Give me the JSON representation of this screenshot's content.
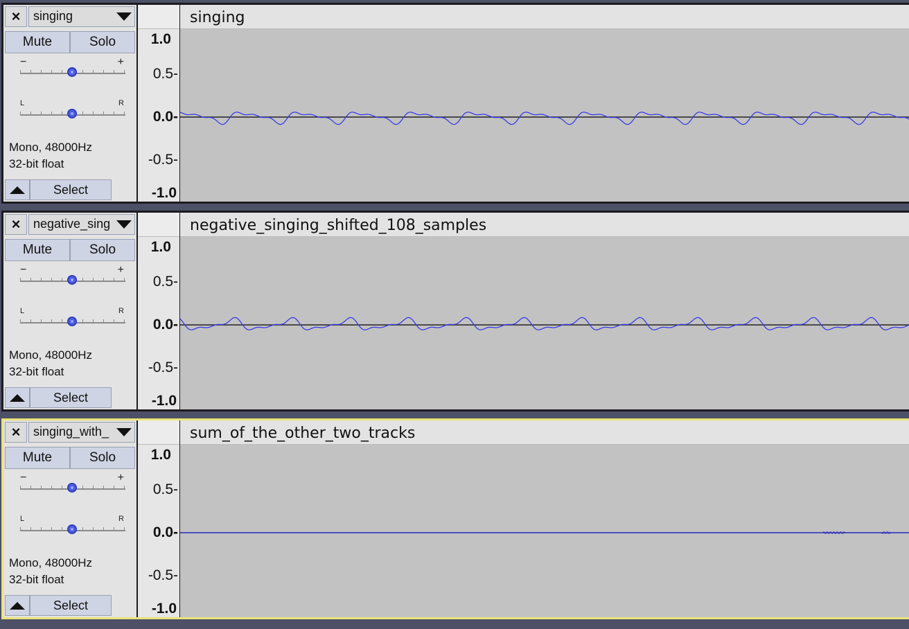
{
  "tracks": [
    {
      "name": "singing",
      "clip_title": "singing",
      "mute_label": "Mute",
      "solo_label": "Solo",
      "gain_minus": "−",
      "gain_plus": "+",
      "pan_left": "L",
      "pan_right": "R",
      "format_line1": "Mono, 48000Hz",
      "format_line2": "32-bit float",
      "select_label": "Select",
      "close_glyph": "×",
      "scale": [
        "1.0",
        "0.5-",
        "0.0-",
        "-0.5-",
        "-1.0"
      ],
      "selected": false,
      "waveform": "periodic",
      "waveform_color": "#3b3be6"
    },
    {
      "name": "negative_sing",
      "clip_title": "negative_singing_shifted_108_samples",
      "mute_label": "Mute",
      "solo_label": "Solo",
      "gain_minus": "−",
      "gain_plus": "+",
      "pan_left": "L",
      "pan_right": "R",
      "format_line1": "Mono, 48000Hz",
      "format_line2": "32-bit float",
      "select_label": "Select",
      "close_glyph": "×",
      "scale": [
        "1.0",
        "0.5-",
        "0.0-",
        "-0.5-",
        "-1.0"
      ],
      "selected": false,
      "waveform": "periodic-inverted",
      "waveform_color": "#3b3be6"
    },
    {
      "name": "singing_with_",
      "clip_title": "sum_of_the_other_two_tracks",
      "mute_label": "Mute",
      "solo_label": "Solo",
      "gain_minus": "−",
      "gain_plus": "+",
      "pan_left": "L",
      "pan_right": "R",
      "format_line1": "Mono, 48000Hz",
      "format_line2": "32-bit float",
      "select_label": "Select",
      "close_glyph": "×",
      "scale": [
        "1.0",
        "0.5-",
        "0.0-",
        "-0.5-",
        "-1.0"
      ],
      "selected": true,
      "waveform": "flat",
      "waveform_color": "#3b3be6"
    }
  ],
  "colors": {
    "background": "#4d5066",
    "waveform_bg": "#c2c2c2",
    "selected_border": "#e9e37a",
    "slider_knob": "#4c5ee8"
  },
  "icons": {
    "close": "close-icon",
    "menu": "chevron-down-icon",
    "collapse": "collapse-up-icon"
  }
}
